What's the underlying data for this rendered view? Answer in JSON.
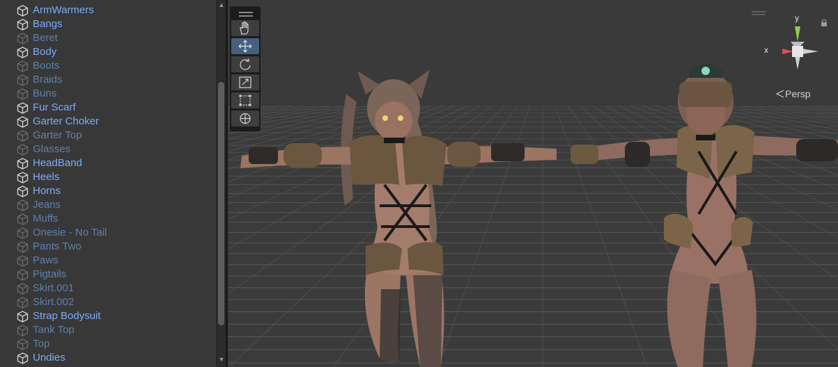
{
  "hierarchy": {
    "items": [
      {
        "label": "ArmWarmers",
        "active": true
      },
      {
        "label": "Bangs",
        "active": true
      },
      {
        "label": "Beret",
        "active": false
      },
      {
        "label": "Body",
        "active": true
      },
      {
        "label": "Boots",
        "active": false
      },
      {
        "label": "Braids",
        "active": false
      },
      {
        "label": "Buns",
        "active": false
      },
      {
        "label": "Fur Scarf",
        "active": true
      },
      {
        "label": "Garter Choker",
        "active": true
      },
      {
        "label": "Garter Top",
        "active": false
      },
      {
        "label": "Glasses",
        "active": false
      },
      {
        "label": "HeadBand",
        "active": true
      },
      {
        "label": "Heels",
        "active": true
      },
      {
        "label": "Horns",
        "active": true
      },
      {
        "label": "Jeans",
        "active": false
      },
      {
        "label": "Muffs",
        "active": false
      },
      {
        "label": "Onesie - No Tail",
        "active": false
      },
      {
        "label": "Pants Two",
        "active": false
      },
      {
        "label": "Paws",
        "active": false
      },
      {
        "label": "Pigtails",
        "active": false
      },
      {
        "label": "Skirt.001",
        "active": false
      },
      {
        "label": "Skirt.002",
        "active": false
      },
      {
        "label": "Strap Bodysuit",
        "active": true
      },
      {
        "label": "Tank Top",
        "active": false
      },
      {
        "label": "Top",
        "active": false
      },
      {
        "label": "Undies",
        "active": true
      }
    ]
  },
  "scene": {
    "tools": [
      "hand-tool",
      "move-tool",
      "rotate-tool",
      "scale-tool",
      "rect-tool",
      "transform-tool"
    ],
    "selected_tool": "move-tool",
    "gizmo": {
      "x_label": "x",
      "y_label": "y",
      "projection_label": "Persp"
    }
  },
  "colors": {
    "active_item": "#7cacf8",
    "inactive_item": "#5f80aa",
    "panel_bg": "#383838",
    "scene_bg": "#3b3b3b",
    "gizmo_x": "#d9534a",
    "gizmo_y": "#8bd14b"
  }
}
